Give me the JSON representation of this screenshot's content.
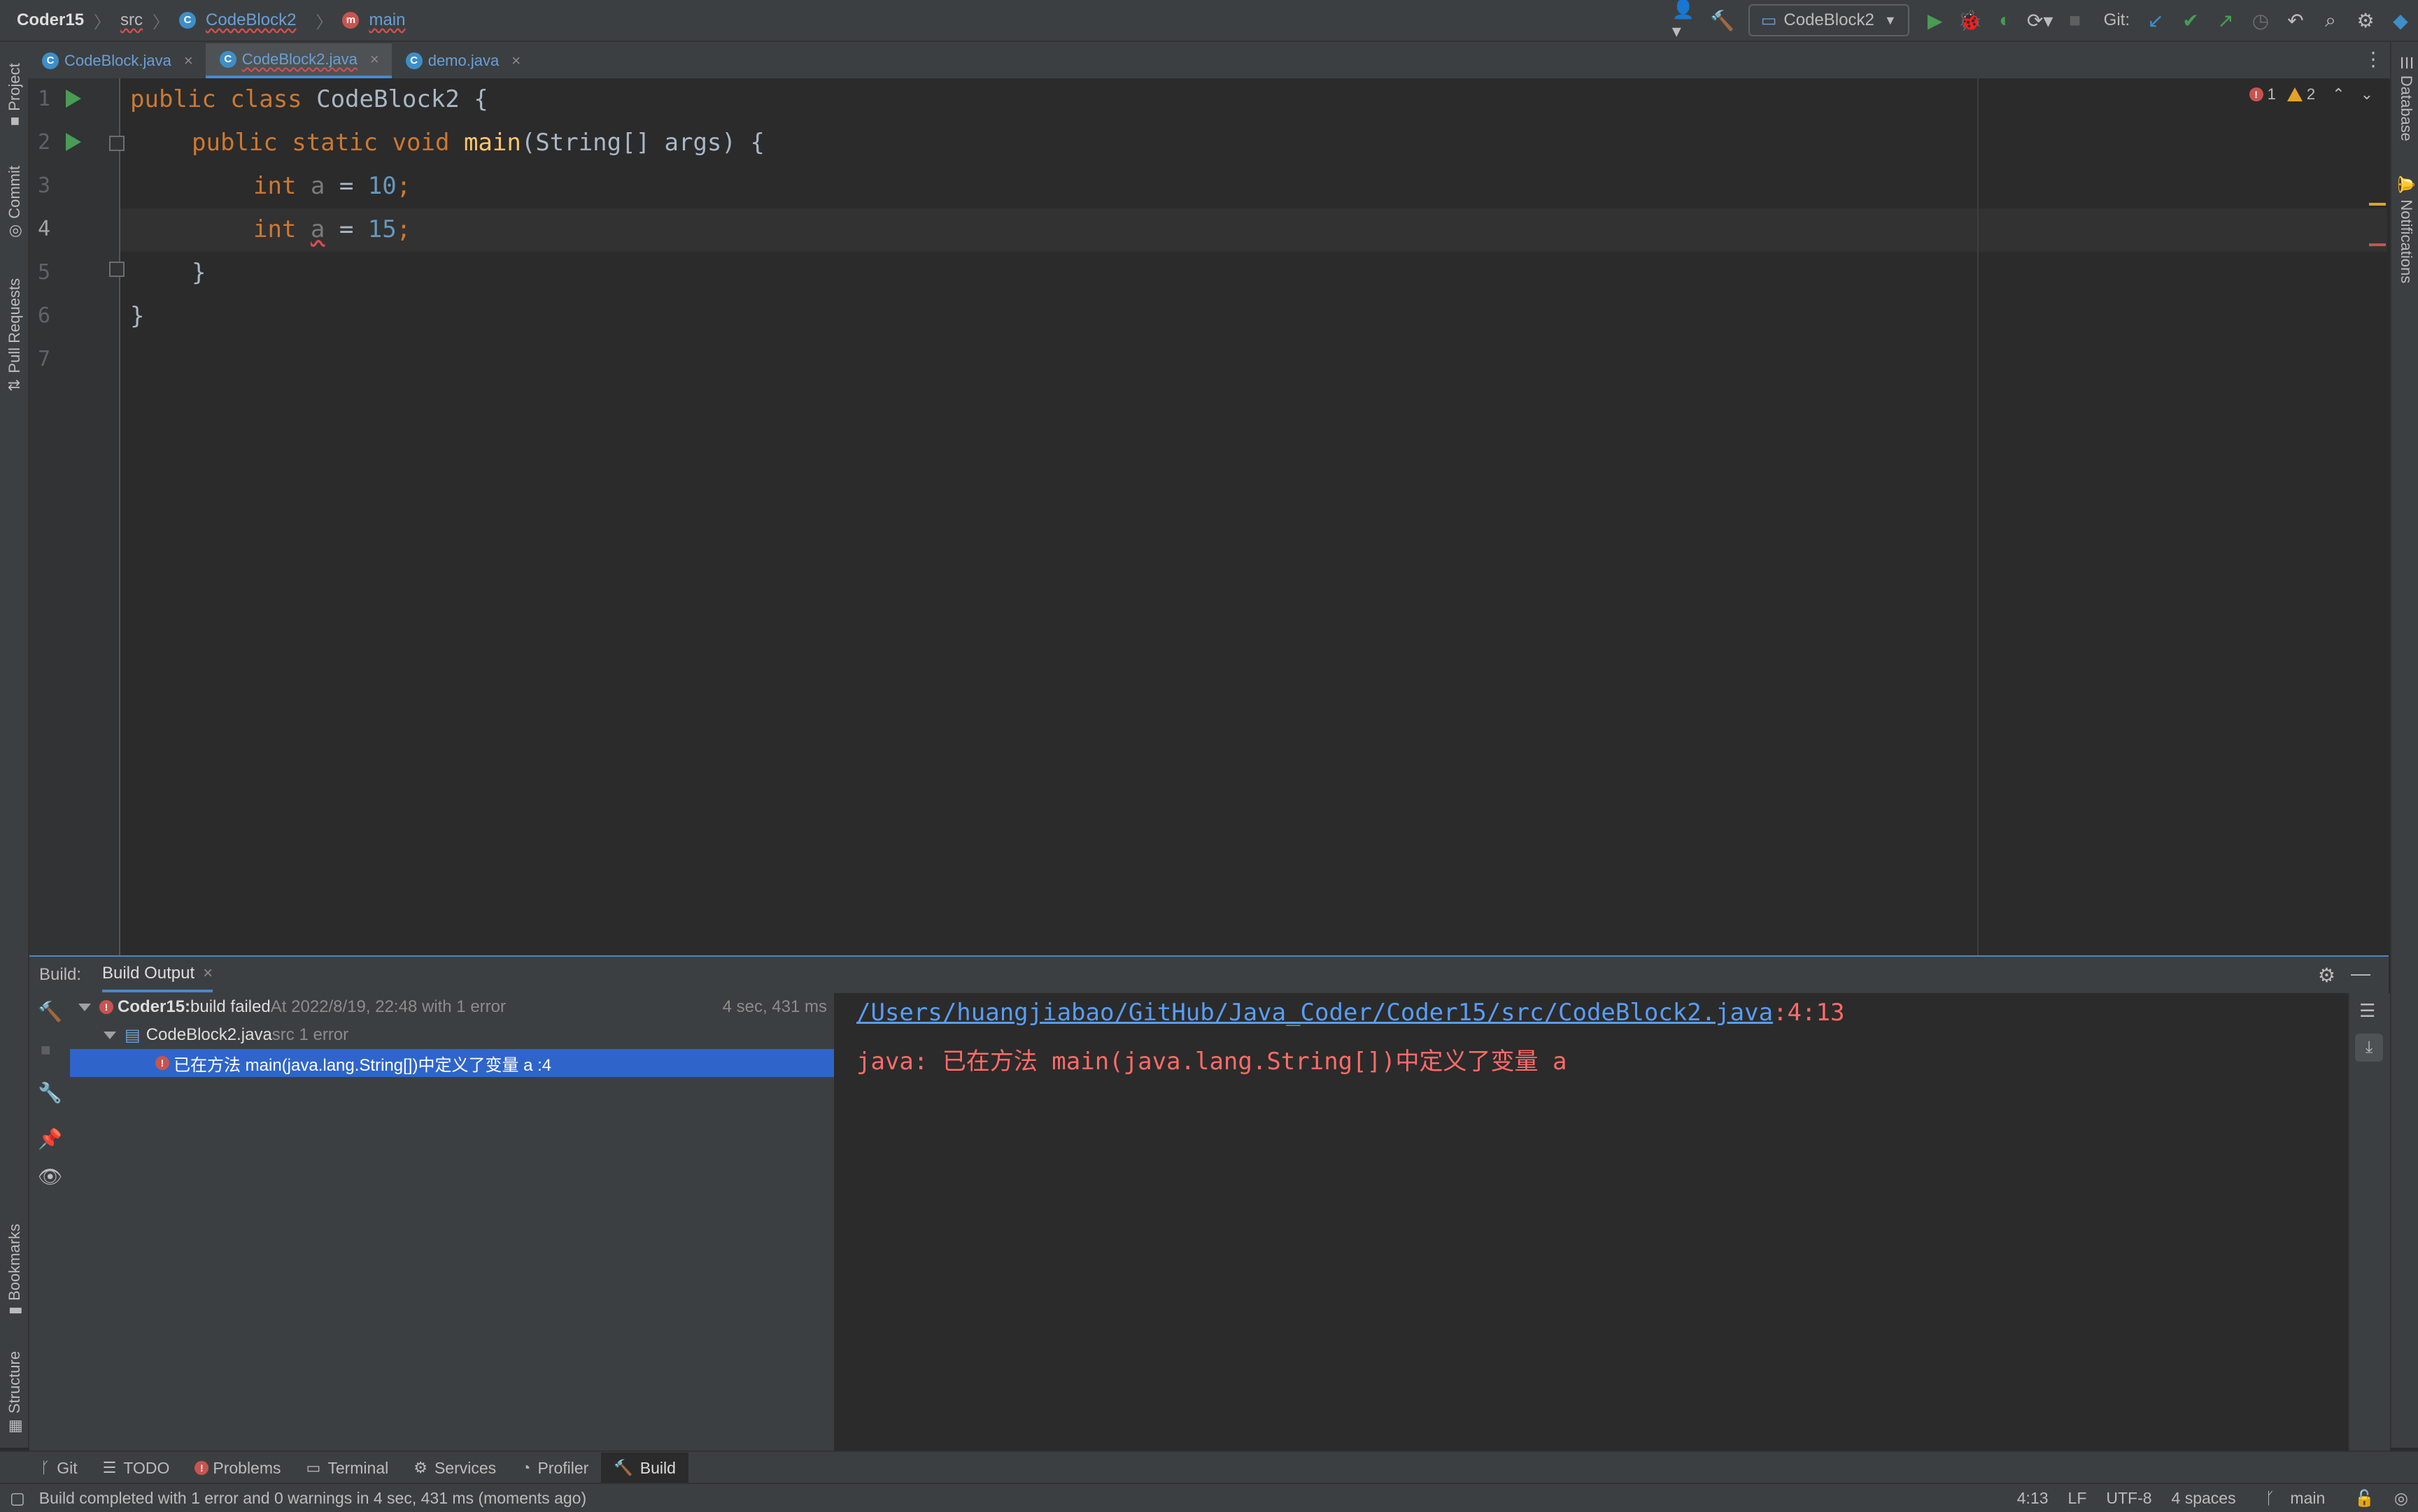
{
  "navbar": {
    "project": "Coder15",
    "crumb_src": "src",
    "crumb_class": "CodeBlock2",
    "crumb_method": "main",
    "run_config": "CodeBlock2",
    "git_label": "Git:"
  },
  "tabs": [
    {
      "label": "CodeBlock.java"
    },
    {
      "label": "CodeBlock2.java"
    },
    {
      "label": "demo.java"
    }
  ],
  "left_stripe": {
    "project": "Project",
    "commit": "Commit",
    "pull_requests": "Pull Requests",
    "bookmarks": "Bookmarks",
    "structure": "Structure"
  },
  "right_stripe": {
    "database": "Database",
    "notifications": "Notifications"
  },
  "editor": {
    "line_numbers": [
      "1",
      "2",
      "3",
      "4",
      "5",
      "6",
      "7"
    ],
    "errors": "1",
    "warnings": "2",
    "code": {
      "l1_kw": "public class ",
      "l1_rest": "CodeBlock2 {",
      "l2_kw": "public static void ",
      "l2_fn": "main",
      "l2_rest": "(String[] args) {",
      "l3_kw": "int ",
      "l3_var": "a",
      "l3_eq": " = ",
      "l3_num": "10",
      "l3_end": ";",
      "l4_kw": "int ",
      "l4_var": "a",
      "l4_eq": " = ",
      "l4_num": "15",
      "l4_end": ";",
      "l5": "}",
      "l6": "}"
    }
  },
  "build": {
    "label": "Build:",
    "tab": "Build Output",
    "root_title": "Coder15:",
    "root_status": " build failed",
    "root_info": " At 2022/8/19, 22:48 with 1 error",
    "root_time": "4 sec, 431 ms",
    "file_name": "CodeBlock2.java",
    "file_info": " src 1 error",
    "error_item": "已在方法 main(java.lang.String[])中定义了变量 a :4",
    "console_path": "/Users/huangjiabao/GitHub/Java_Coder/Coder15/src/CodeBlock2.java",
    "console_pos": ":4:13",
    "console_msg": "java: 已在方法 main(java.lang.String[])中定义了变量 a"
  },
  "bottom_tabs": [
    {
      "label": "Git"
    },
    {
      "label": "TODO"
    },
    {
      "label": "Problems"
    },
    {
      "label": "Terminal"
    },
    {
      "label": "Services"
    },
    {
      "label": "Profiler"
    },
    {
      "label": "Build"
    }
  ],
  "status": {
    "message": "Build completed with 1 error and 0 warnings in 4 sec, 431 ms (moments ago)",
    "position": "4:13",
    "line_sep": "LF",
    "encoding": "UTF-8",
    "indent": "4 spaces",
    "branch": "main"
  },
  "colors": {
    "accent": "#4a88c7",
    "error": "#ff5f56",
    "run_green": "#499c54",
    "selection": "#2f65ca"
  }
}
